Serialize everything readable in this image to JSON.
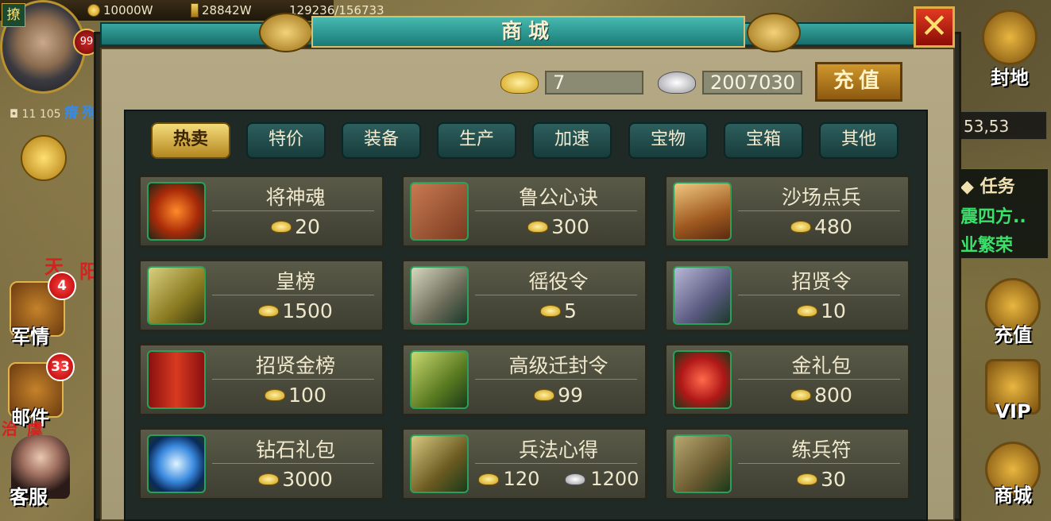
{
  "hud": {
    "avatar_tag": "撩",
    "level": "99",
    "gold": "10000W",
    "food": "28842W",
    "troops": "129236/156733",
    "small_info": "11",
    "small_num": "105",
    "small_tag": "瘠",
    "small_tag2": "殉"
  },
  "left_menu": {
    "junqing": {
      "label": "军情",
      "badge": "4"
    },
    "youjian": {
      "label": "邮件",
      "badge": "33"
    },
    "kefu": {
      "label": "客服"
    },
    "red_texts": [
      "天",
      "阳",
      "治",
      "虞"
    ]
  },
  "right_menu": {
    "fengdi": "封地",
    "coords": "53,53",
    "task_title": "任务",
    "task_line1": "震四方..",
    "task_line2": "业繁荣",
    "chongzhi": "充值",
    "vip": "VIP",
    "shangcheng": "商城"
  },
  "shop": {
    "title": "商城",
    "gold_amount": "7",
    "silver_amount": "2007030",
    "recharge_label": "充值",
    "close_label": "✕",
    "tabs": [
      "热卖",
      "特价",
      "装备",
      "生产",
      "加速",
      "宝物",
      "宝箱",
      "其他"
    ],
    "active_tab": "热卖",
    "items": [
      {
        "name": "将神魂",
        "price": "20",
        "icon": "spirit-orb-icon"
      },
      {
        "name": "鲁公心诀",
        "price": "300",
        "icon": "stone-tablet-icon"
      },
      {
        "name": "沙场点兵",
        "price": "480",
        "icon": "battlefield-icon"
      },
      {
        "name": "皇榜",
        "price": "1500",
        "icon": "imperial-scroll-icon"
      },
      {
        "name": "徭役令",
        "price": "5",
        "icon": "labor-scroll-icon"
      },
      {
        "name": "招贤令",
        "price": "10",
        "icon": "recruit-token-icon"
      },
      {
        "name": "招贤金榜",
        "price": "100",
        "icon": "gold-banner-icon"
      },
      {
        "name": "高级迁封令",
        "price": "99",
        "icon": "relocation-tag-icon"
      },
      {
        "name": "金礼包",
        "price": "800",
        "icon": "gift-box-icon"
      },
      {
        "name": "钻石礼包",
        "price": "3000",
        "icon": "diamond-icon"
      },
      {
        "name": "兵法心得",
        "price": "120",
        "price_silver": "1200",
        "icon": "strategy-book-icon"
      },
      {
        "name": "练兵符",
        "price": "30",
        "icon": "training-talisman-icon"
      }
    ]
  },
  "colors": {
    "accent": "#1a7a76",
    "gold": "#d0a018",
    "panel": "#1f2a26"
  }
}
